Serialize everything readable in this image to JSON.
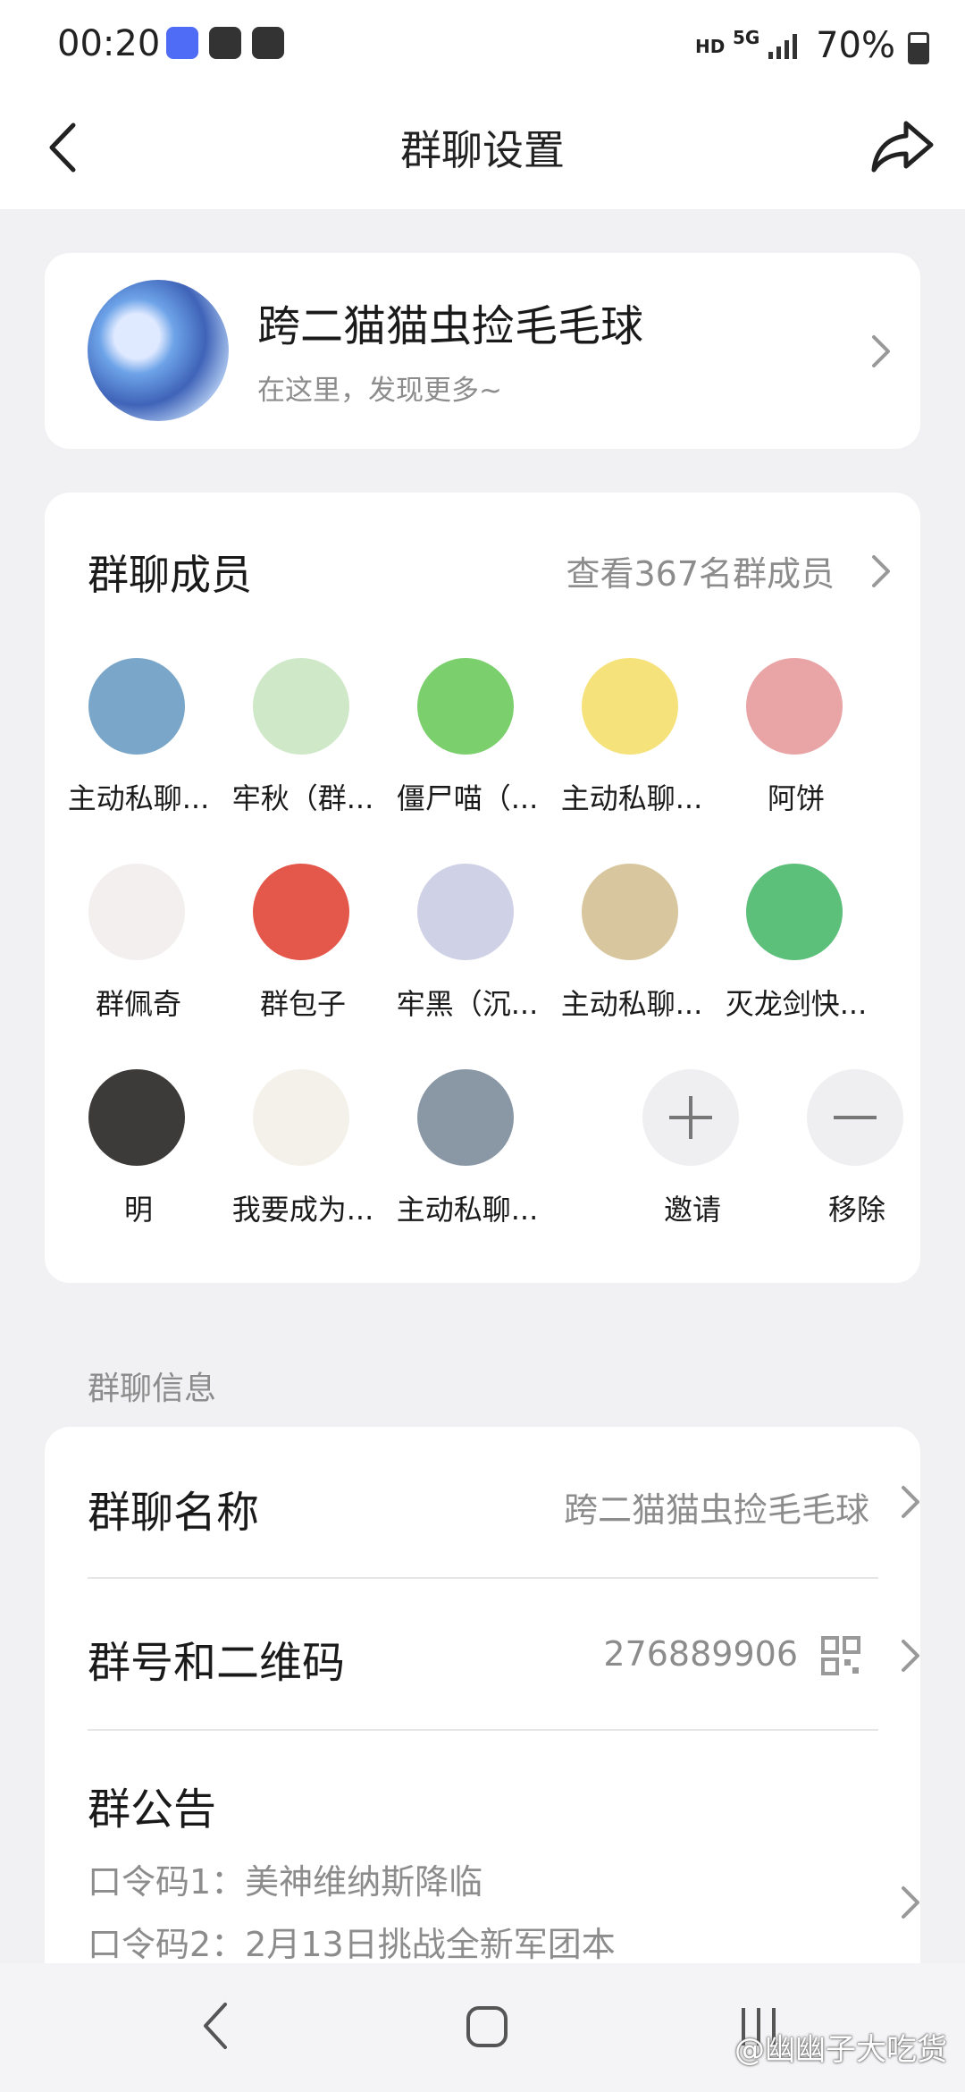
{
  "status_bar": {
    "time": "00:20",
    "hd_label": "HD",
    "network_label": "5G",
    "battery_percent": "70%",
    "battery_level": 0.7
  },
  "nav": {
    "title": "群聊设置",
    "icons": {
      "back": "chevron-left-icon",
      "share": "share-arrow-icon"
    }
  },
  "group": {
    "name": "跨二猫猫虫捡毛毛球",
    "subtitle": "在这里，发现更多~"
  },
  "members": {
    "title": "群聊成员",
    "view_all": "查看367名群成员",
    "items": [
      {
        "name": "主动私聊...",
        "color": "#7aa7c9"
      },
      {
        "name": "牢秋（群...",
        "color": "#cfe8c8"
      },
      {
        "name": "僵尸喵（...",
        "color": "#7ccf6d"
      },
      {
        "name": "主动私聊...",
        "color": "#f6e27a"
      },
      {
        "name": "阿饼",
        "color": "#e9a4a6"
      },
      {
        "name": "群佩奇",
        "color": "#f2efee"
      },
      {
        "name": "群包子",
        "color": "#e4574b"
      },
      {
        "name": "牢黑（沉...",
        "color": "#cfd2e6"
      },
      {
        "name": "主动私聊...",
        "color": "#d8c79e"
      },
      {
        "name": "灭龙剑快...",
        "color": "#5cbf7a"
      },
      {
        "name": "明",
        "color": "#3d3a3a"
      },
      {
        "name": "我要成为...",
        "color": "#f4f1ea"
      },
      {
        "name": "主动私聊...",
        "color": "#8a98a6"
      }
    ],
    "invite_label": "邀请",
    "remove_label": "移除"
  },
  "info": {
    "section_label": "群聊信息",
    "name_label": "群聊名称",
    "name_value": "跨二猫猫虫捡毛毛球",
    "number_label": "群号和二维码",
    "number_value": "276889906",
    "notice_label": "群公告",
    "notice_line1": "口令码1：美神维纳斯降临",
    "notice_line2": "口令码2：2月13日挑战全新军团本"
  },
  "watermark": "@幽幽子大吃货"
}
